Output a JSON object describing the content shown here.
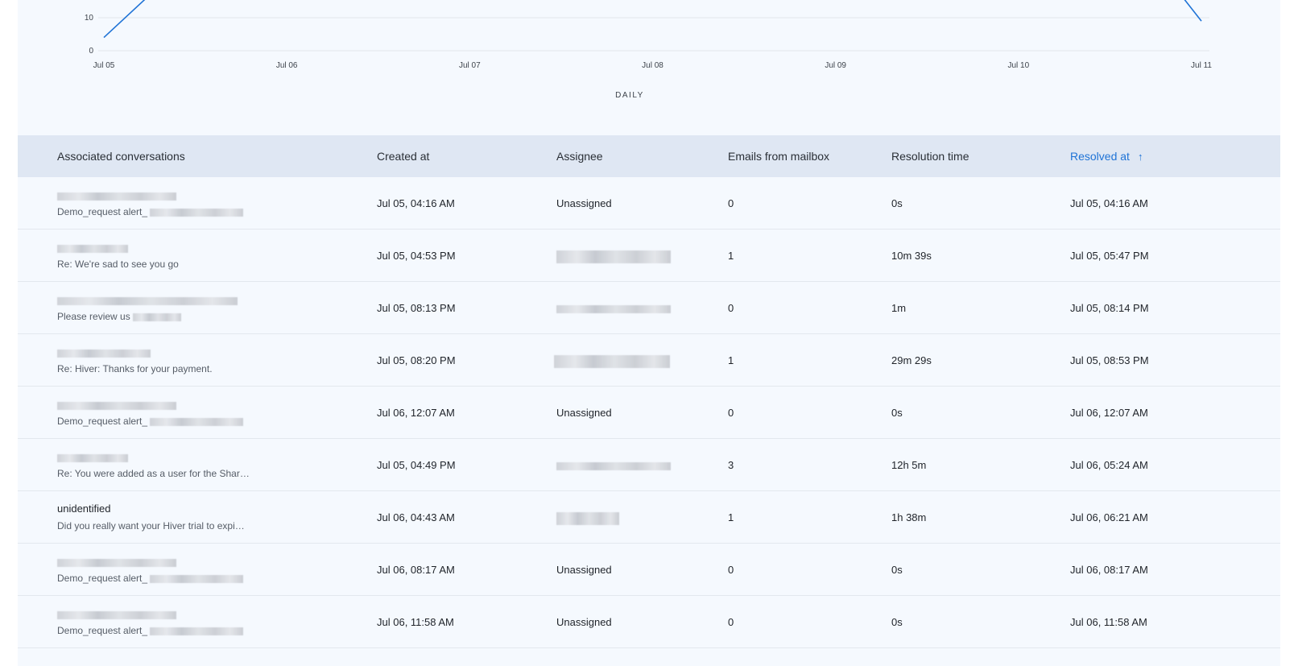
{
  "chart_data": {
    "type": "line",
    "x": [
      "Jul 05",
      "Jul 06",
      "Jul 07",
      "Jul 08",
      "Jul 09",
      "Jul 10",
      "Jul 11"
    ],
    "y_ticks": [
      "10",
      "0"
    ],
    "xlabel": "DAILY",
    "series": [
      {
        "color": "#1f73d6",
        "partial_visible_points": [
          [
            0,
            4
          ],
          [
            0.33,
            21
          ],
          [
            5.83,
            21
          ],
          [
            6,
            9
          ]
        ]
      }
    ]
  },
  "table": {
    "headers": {
      "conversations": "Associated conversations",
      "created": "Created at",
      "assignee": "Assignee",
      "emails": "Emails from mailbox",
      "resolution": "Resolution time",
      "resolved": "Resolved at",
      "sort_icon": "arrow-up-icon"
    },
    "rows": [
      {
        "title": "",
        "subject": "Demo_request alert_",
        "created": "Jul 05, 04:16 AM",
        "assignee": "Unassigned",
        "emails": "0",
        "resolution": "0s",
        "resolved": "Jul 05, 04:16 AM"
      },
      {
        "title": "",
        "subject": "Re: We're sad to see you go",
        "created": "Jul 05, 04:53 PM",
        "assignee": "",
        "emails": "1",
        "resolution": "10m 39s",
        "resolved": "Jul 05, 05:47 PM"
      },
      {
        "title": "",
        "subject": "Please review us",
        "created": "Jul 05, 08:13 PM",
        "assignee": "",
        "emails": "0",
        "resolution": "1m",
        "resolved": "Jul 05, 08:14 PM"
      },
      {
        "title": "",
        "subject": "Re: Hiver: Thanks for your payment.",
        "created": "Jul 05, 08:20 PM",
        "assignee": "",
        "emails": "1",
        "resolution": "29m 29s",
        "resolved": "Jul 05, 08:53 PM"
      },
      {
        "title": "",
        "subject": "Demo_request alert_",
        "created": "Jul 06, 12:07 AM",
        "assignee": "Unassigned",
        "emails": "0",
        "resolution": "0s",
        "resolved": "Jul 06, 12:07 AM"
      },
      {
        "title": "",
        "subject": "Re: You were added as a user for the Shar…",
        "created": "Jul 05, 04:49 PM",
        "assignee": "",
        "emails": "3",
        "resolution": "12h 5m",
        "resolved": "Jul 06, 05:24 AM"
      },
      {
        "title": "unidentified",
        "subject": "Did you really want your Hiver trial to expi…",
        "created": "Jul 06, 04:43 AM",
        "assignee": "",
        "emails": "1",
        "resolution": "1h 38m",
        "resolved": "Jul 06, 06:21 AM"
      },
      {
        "title": "",
        "subject": "Demo_request alert_",
        "created": "Jul 06, 08:17 AM",
        "assignee": "Unassigned",
        "emails": "0",
        "resolution": "0s",
        "resolved": "Jul 06, 08:17 AM"
      },
      {
        "title": "",
        "subject": "Demo_request alert_",
        "created": "Jul 06, 11:58 AM",
        "assignee": "Unassigned",
        "emails": "0",
        "resolution": "0s",
        "resolved": "Jul 06, 11:58 AM"
      }
    ]
  }
}
